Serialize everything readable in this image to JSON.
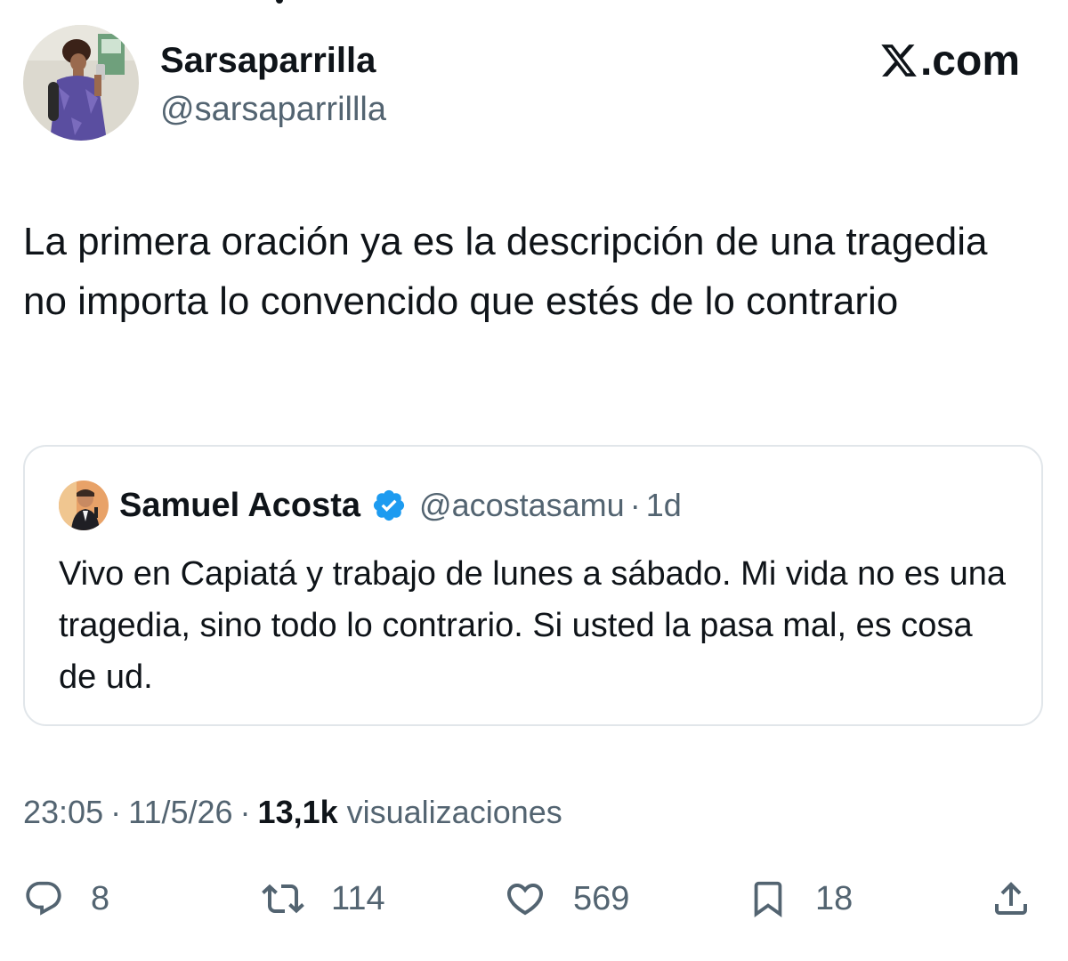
{
  "author": {
    "name": "Sarsaparrilla",
    "handle": "@sarsaparrillla"
  },
  "brand": {
    "logo_text": ".com",
    "logo_icon": "x-logo-icon"
  },
  "tweet": {
    "text": "La primera oración ya es la descripción de una tragedia no importa lo convencido que estés de lo contrario"
  },
  "quote": {
    "name": "Samuel Acosta",
    "verified_icon": "verified-badge-icon",
    "handle": "@acostasamu",
    "separator": "·",
    "time": "1d",
    "text": "Vivo en Capiatá y trabajo de lunes a sábado. Mi vida no es una tragedia, sino todo lo contrario.  Si usted la pasa mal, es cosa de ud."
  },
  "meta": {
    "time": "23:05",
    "separator": "·",
    "date": "11/5/26",
    "views_count": "13,1k",
    "views_label": "visualizaciones"
  },
  "actions": {
    "replies": "8",
    "reposts": "114",
    "likes": "569",
    "bookmarks": "18"
  },
  "colors": {
    "text": "#0f1419",
    "secondary": "#536471",
    "border": "#e1e6ea",
    "verified": "#1d9bf0"
  }
}
